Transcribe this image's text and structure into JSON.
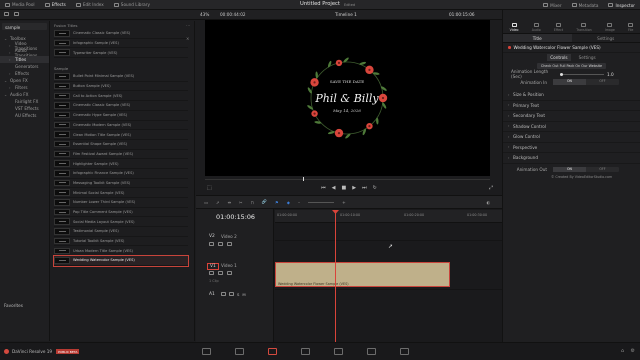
{
  "topbar": {
    "media_pool": "Media Pool",
    "effects": "Effects",
    "edit_index": "Edit Index",
    "sound_library": "Sound Library",
    "project_title": "Untitled Project",
    "project_status": "Edited",
    "mixer": "Mixer",
    "metadata": "Metadata",
    "inspector": "Inspector"
  },
  "viewer": {
    "zoom": "43%",
    "timecode_left": "00:00:44:02",
    "timeline_name": "Timeline 1",
    "timecode_right": "01:00:15:06",
    "card": {
      "line1": "SAVE THE DATE",
      "line2": "Phil & Billy",
      "line3": "May 14, 2026"
    }
  },
  "left_panel": {
    "search_value": "sample",
    "toolbox": "Toolbox",
    "video_transitions": "Video Transitions",
    "audio_transitions": "Audio Transitions",
    "titles": "Titles",
    "generators": "Generators",
    "effects": "Effects",
    "open_fx": "Open FX",
    "filters": "Filters",
    "audio_fx": "Audio FX",
    "fairlight_fx": "Fairlight FX",
    "vst_effects": "VST Effects",
    "au_effects": "AU Effects",
    "favorites": "Favorites"
  },
  "effects_list": {
    "group_fusion": "Fusion Titles",
    "fusion_items": [
      "Cinematic Classic Sample (VES)",
      "Infographic Sample (VES)",
      "Typewriter Sample (VES)"
    ],
    "group_sample": "Sample",
    "sample_items": [
      "Bullet Point Minimal Sample (VES)",
      "Button Sample (VES)",
      "Call to Action Sample (VES)",
      "Cinematic Classic Sample (VES)",
      "Cinematic Hype Sample (VES)",
      "Cinematic Modern Sample (VES)",
      "Clean Motion Title Sample (VES)",
      "Essential Shape Sample (VES)",
      "Film Festival Award Sample (VES)",
      "Highlighter Sample (VES)",
      "Infographic Finance Sample (VES)",
      "Messaging Toolkit Sample (VES)",
      "Minimal Social Sample (VES)",
      "Number Lower Third Sample (VES)",
      "Pop Title Comment Sample (VES)",
      "Social Media Layout Sample (VES)",
      "Testimonial Sample (VES)",
      "Tutorial Toolkit Sample (VES)",
      "Urban Modern Title Sample (VES)",
      "Wedding Watercolor Sample (VES)"
    ]
  },
  "timeline": {
    "timecode": "01:00:15:06",
    "ruler_ticks": [
      "01:00:00:00",
      "01:00:10:00",
      "01:00:20:00",
      "01:00:30:00"
    ],
    "v2": "V2",
    "video2": "Video 2",
    "v1": "V1",
    "video1": "Video 1",
    "a1": "A1",
    "clip_label": "Wedding Watercolor Flower Sample (VES)",
    "clip_count": "1 Clip"
  },
  "inspector": {
    "header": "Timeline - Fusion Title - We...tercolor Flower Sample (VES)",
    "tabs": [
      "Video",
      "Audio",
      "Effect",
      "Transition",
      "Image",
      "File"
    ],
    "subtab_title": "Title",
    "subtab_settings": "Settings",
    "tool_name": "Wedding Watercolor Flower Sample (VES)",
    "controls": "Controls",
    "settings": "Settings",
    "promo_button": "Check Out Full Pack On Our Website",
    "anim_length_label": "Animation Length (Sec)",
    "anim_length_value": "1.0",
    "anim_in_label": "Animation In",
    "anim_out_label": "Animation Out",
    "on": "ON",
    "off": "OFF",
    "sections": [
      "Size & Position",
      "Primary Text",
      "Secondary Text",
      "Shadow Control",
      "Glow Control",
      "Perspective",
      "Background"
    ],
    "credit": "© Created By VideoEditorStudio.com"
  },
  "bottombar": {
    "app_name": "DaVinci Resolve 19",
    "badge": "PUBLIC BETA"
  },
  "colors": {
    "accent_red": "#d9443a",
    "clip_fill": "#bfb08a",
    "panel_bg": "#1f1f21"
  }
}
